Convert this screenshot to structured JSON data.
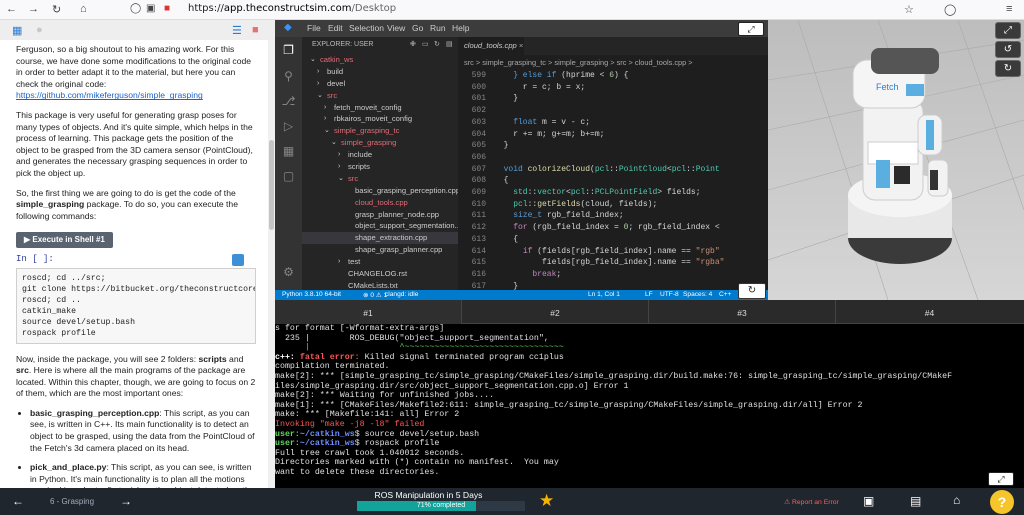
{
  "browser": {
    "url_scheme": "https://",
    "url_host": "app.theconstructsim.com",
    "url_path": "/Desktop"
  },
  "notebook": {
    "para1_text": "Ferguson, so a big shoutout to his amazing work. For this course, we have done some modifications to the original code in order to better adapt it to the material, but here you can check the original code: ",
    "para1_link": "https://github.com/mikeferguson/simple_grasping",
    "para2": "This package is very useful for generating grasp poses for many types of objects. And it's quite simple, which helps in the process of learning. This package gets the position of the object to be grasped from the 3D camera sensor (PointCloud), and generates the necessary grasping sequences in order to pick the object up.",
    "para3_a": "So, the first thing we are going to do is get the code of the ",
    "para3_bold": "simple_grasping",
    "para3_b": " package. To do so, you can execute the following commands:",
    "exec_button": "Execute in Shell #1",
    "in_label": "In [ ]:",
    "code_lines": [
      "roscd; cd ../src;",
      "git clone https://bitbucket.org/theconstructcore/s",
      "roscd; cd ..",
      "catkin_make",
      "source devel/setup.bash",
      "rospack profile"
    ],
    "para4_a": "Now, inside the package, you will see 2 folders: ",
    "para4_b1": "scripts",
    "para4_and": " and ",
    "para4_b2": "src",
    "para4_c": ". Here is where all the main programs of the package are located. Within this chapter, though, we are going to focus on 2 of them, which are the most important ones:",
    "bullet1_title": "basic_grasping_perception.cpp",
    "bullet1_text": ": This script, as you can see, is written in C++. Its main functionality is to detect an object to be grasped, using the data from the PointCloud of the Fetch's 3d camera placed on its head.",
    "bullet2_title": "pick_and_place.py",
    "bullet2_text": ": This script, as you can see, is written in Python. It's main functionality is to plan all the motions required in order to, first, pick up the object detected on the table and then, place it in another position on the table. Of course, it will use the already created MoveIt package to do all the motion."
  },
  "vscode": {
    "menu": [
      "File",
      "Edit",
      "Selection",
      "View",
      "Go",
      "Run",
      "Help"
    ],
    "explorer_header": "EXPLORER: USER",
    "tree": [
      {
        "label": "catkin_ws",
        "indent": 0,
        "chev": "v",
        "color": "#e06c75"
      },
      {
        "label": "build",
        "indent": 1,
        "chev": ">",
        "color": "#ccc"
      },
      {
        "label": "devel",
        "indent": 1,
        "chev": ">",
        "color": "#ccc"
      },
      {
        "label": "src",
        "indent": 1,
        "chev": "v",
        "color": "#e06c75"
      },
      {
        "label": "fetch_moveit_config",
        "indent": 2,
        "chev": ">",
        "color": "#ccc"
      },
      {
        "label": "rbkairos_moveit_config",
        "indent": 2,
        "chev": ">",
        "color": "#ccc"
      },
      {
        "label": "simple_grasping_tc",
        "indent": 2,
        "chev": "v",
        "color": "#e06c75"
      },
      {
        "label": "simple_grasping",
        "indent": 3,
        "chev": "v",
        "color": "#e06c75"
      },
      {
        "label": "include",
        "indent": 4,
        "chev": ">",
        "color": "#ccc"
      },
      {
        "label": "scripts",
        "indent": 4,
        "chev": ">",
        "color": "#ccc"
      },
      {
        "label": "src",
        "indent": 4,
        "chev": "v",
        "color": "#e06c75"
      },
      {
        "label": "basic_grasping_perception.cpp",
        "indent": 5,
        "chev": "",
        "color": "#ccc"
      },
      {
        "label": "cloud_tools.cpp",
        "indent": 5,
        "chev": "",
        "color": "#e06c75"
      },
      {
        "label": "grasp_planner_node.cpp",
        "indent": 5,
        "chev": "",
        "color": "#ccc"
      },
      {
        "label": "object_support_segmentation....",
        "indent": 5,
        "chev": "",
        "color": "#ccc"
      },
      {
        "label": "shape_extraction.cpp",
        "indent": 5,
        "chev": "",
        "color": "#ccc",
        "sel": true
      },
      {
        "label": "shape_grasp_planner.cpp",
        "indent": 5,
        "chev": "",
        "color": "#ccc"
      },
      {
        "label": "test",
        "indent": 4,
        "chev": ">",
        "color": "#ccc"
      },
      {
        "label": "CHANGELOG.rst",
        "indent": 4,
        "chev": "",
        "color": "#ccc"
      },
      {
        "label": "CMakeLists.txt",
        "indent": 4,
        "chev": "",
        "color": "#ccc"
      },
      {
        "label": "package.xml",
        "indent": 4,
        "chev": "",
        "color": "#ccc"
      }
    ],
    "tab": "cloud_tools.cpp",
    "breadcrumb": "src  >  simple_grasping_tc  >  simple_grasping  >  src  >  cloud_tools.cpp  >",
    "line_numbers": [
      "",
      "",
      "",
      "",
      "",
      "",
      "",
      "",
      "",
      "",
      "",
      "",
      "",
      "",
      "",
      "",
      "",
      "",
      "",
      "",
      ""
    ],
    "status": {
      "python": "Python 3.8.10 64-bit",
      "errors": "⊗ 0 ⚠ 1",
      "clangd": "clangd: idle",
      "pos": "Ln 1, Col 1",
      "eol": "LF",
      "enc": "UTF-8",
      "spaces": "Spaces: 4",
      "lang": "C++"
    }
  },
  "terminal": {
    "tabs": [
      "#1",
      "#2",
      "#3",
      "#4"
    ],
    "lines": [
      "s for format [-Wformat-extra-args]",
      "  235 |        ROS_DEBUG(\"object_support_segmentation\",",
      "      |                  ^~~~~~~~~~~~~~~~~~~~~~~~~~~~~~~~~",
      "c++: fatal error: Killed signal terminated program cc1plus",
      "compilation terminated.",
      "make[2]: *** [simple_grasping_tc/simple_grasping/CMakeFiles/simple_grasping.dir/build.make:76: simple_grasping_tc/simple_grasping/CMakeF",
      "iles/simple_grasping.dir/src/object_support_segmentation.cpp.o] Error 1",
      "make[2]: *** Waiting for unfinished jobs....",
      "make[1]: *** [CMakeFiles/Makefile2:611: simple_grasping_tc/simple_grasping/CMakeFiles/simple_grasping.dir/all] Error 2",
      "make: *** [Makefile:141: all] Error 2",
      "Invoking \"make -j8 -l8\" failed",
      "user:~/catkin_ws$ source devel/setup.bash",
      "user:~/catkin_ws$ rospack profile",
      "Full tree crawl took 1.040012 seconds.",
      "Directories marked with (*) contain no manifest.  You may",
      "want to delete these directories."
    ]
  },
  "bottom": {
    "chapter": "6 - Grasping",
    "course_title": "ROS Manipulation in 5 Days",
    "progress_text": "71% completed",
    "progress": 0.71,
    "report": "Report an Error",
    "help": "?"
  }
}
